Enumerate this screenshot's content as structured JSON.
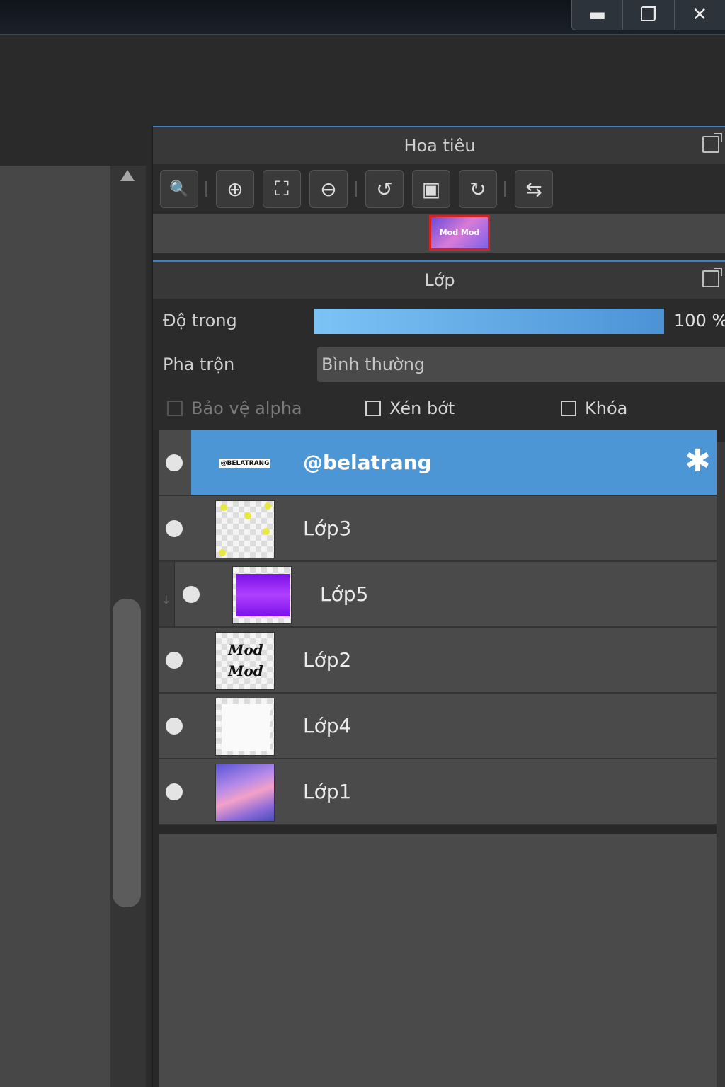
{
  "window": {
    "controls": [
      {
        "name": "minimize",
        "glyph": "▬"
      },
      {
        "name": "restore",
        "glyph": "❐"
      },
      {
        "name": "close",
        "glyph": "✕"
      }
    ]
  },
  "navigator": {
    "title": "Hoa tiêu",
    "thumbnail_text": "Mod Mod",
    "tools": [
      {
        "name": "zoom-actual-icon",
        "glyph": "🔍"
      },
      {
        "name": "zoom-in-icon",
        "glyph": "⊕"
      },
      {
        "name": "fit-screen-icon",
        "glyph": "⛶"
      },
      {
        "name": "zoom-out-icon",
        "glyph": "⊖"
      },
      {
        "name": "rotate-left-icon",
        "glyph": "↺"
      },
      {
        "name": "reset-view-icon",
        "glyph": "▣"
      },
      {
        "name": "rotate-right-icon",
        "glyph": "↻"
      },
      {
        "name": "flip-horizontal-icon",
        "glyph": "⇆"
      }
    ]
  },
  "layers_panel": {
    "title": "Lớp",
    "opacity_label": "Độ trong",
    "opacity_value": "100 %",
    "opacity_fraction": 1.0,
    "blend_label": "Pha trộn",
    "blend_value": "Bình thường",
    "checkboxes": {
      "protect_alpha": "Bảo vệ alpha",
      "clipping": "Xén bớt",
      "lock": "Khóa"
    },
    "layers": [
      {
        "name": "@belatrang",
        "selected": true,
        "thumb_text": "@BELATRANG"
      },
      {
        "name": "Lớp3"
      },
      {
        "name": "Lớp5",
        "clipped": true
      },
      {
        "name": "Lớp2",
        "thumb_text": "Mod"
      },
      {
        "name": "Lớp4"
      },
      {
        "name": "Lớp1"
      }
    ]
  }
}
